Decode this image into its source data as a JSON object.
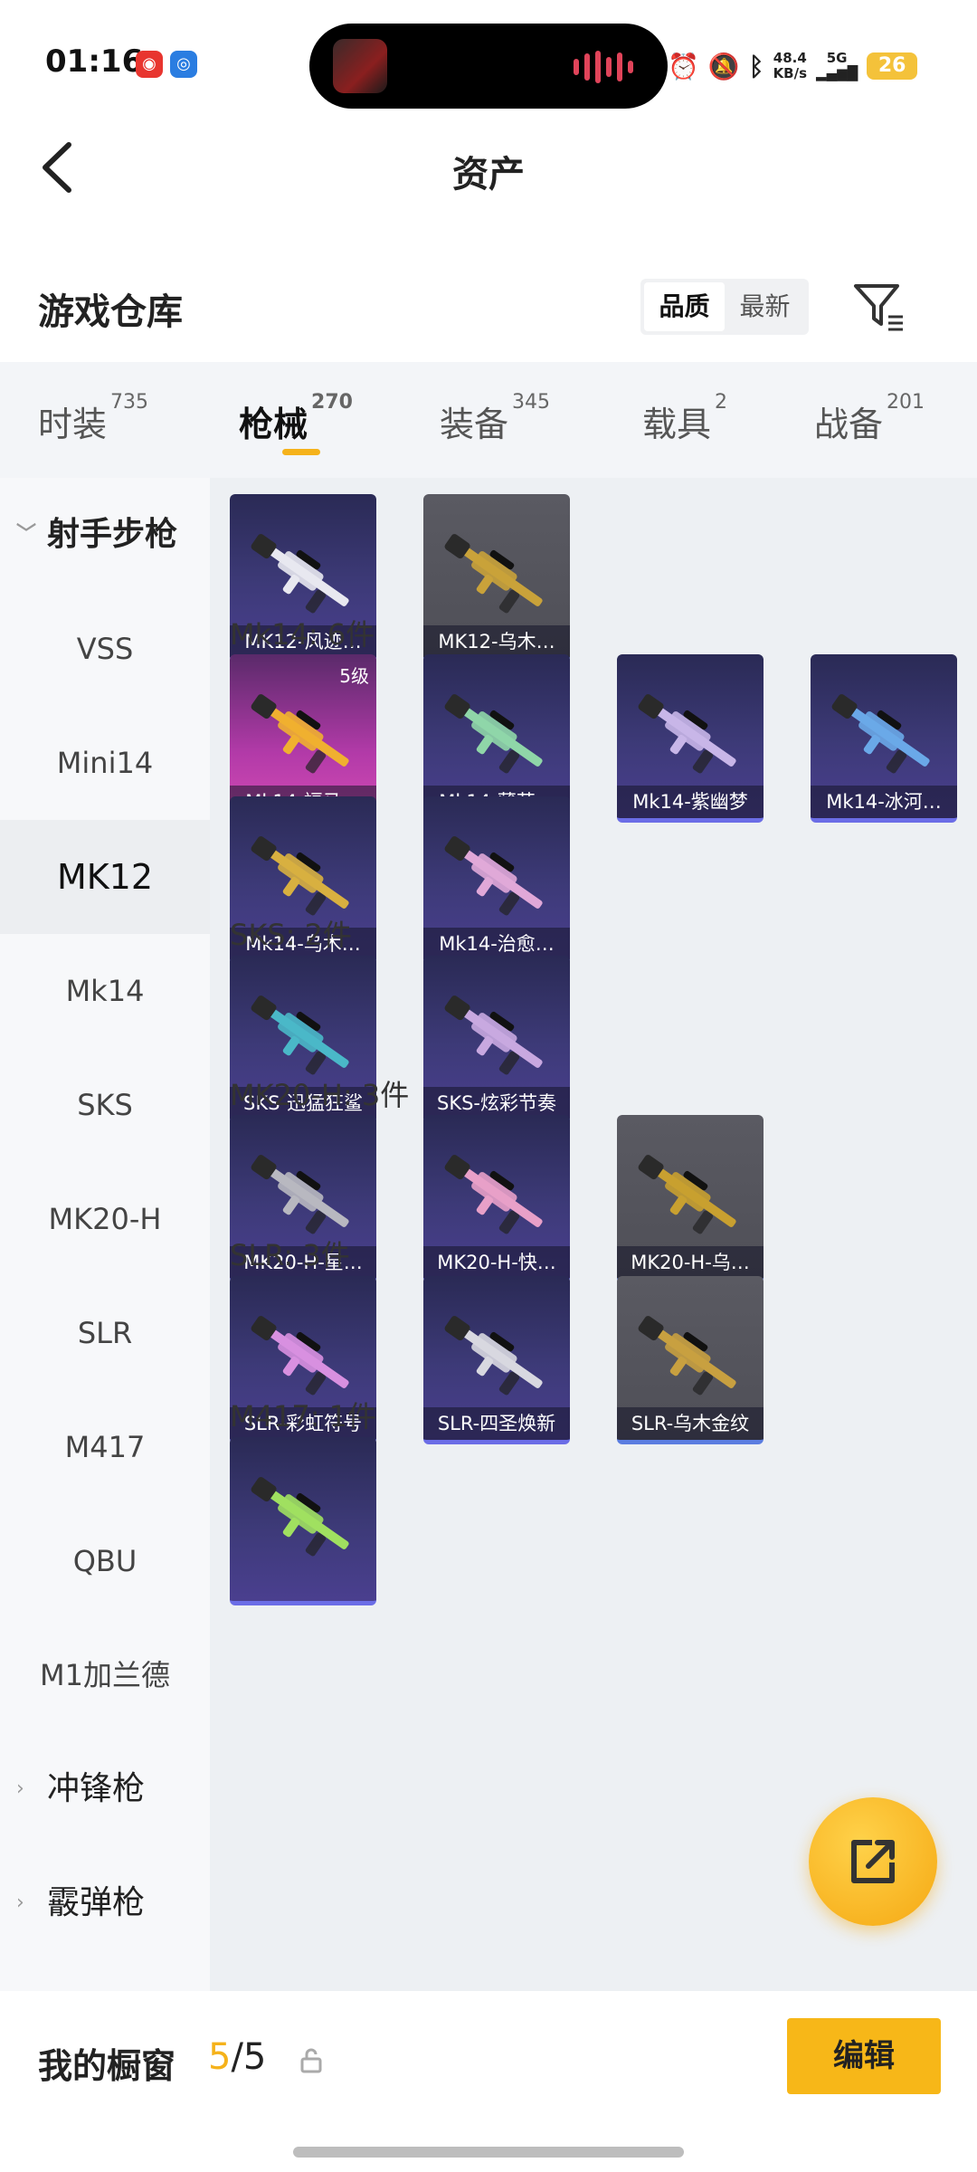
{
  "status_bar": {
    "time": "01:16",
    "net_speed_value": "48.4",
    "net_speed_unit": "KB/s",
    "network": "5G",
    "battery": "26"
  },
  "header": {
    "title": "资产"
  },
  "section": {
    "title": "游戏仓库",
    "sort_options": [
      "品质",
      "最新"
    ],
    "sort_selected": "品质"
  },
  "tabs": [
    {
      "label": "时装",
      "count": "735"
    },
    {
      "label": "枪械",
      "count": "270"
    },
    {
      "label": "装备",
      "count": "345"
    },
    {
      "label": "载具",
      "count": "2"
    },
    {
      "label": "战备",
      "count": "201"
    }
  ],
  "active_tab": "枪械",
  "sidebar": {
    "group_open": "射手步枪",
    "items": [
      "VSS",
      "Mini14",
      "MK12",
      "Mk14",
      "SKS",
      "MK20-H",
      "SLR",
      "M417",
      "QBU",
      "M1加兰德"
    ],
    "active_item": "MK12",
    "collapsed_groups": [
      "冲锋枪",
      "霰弹枪"
    ]
  },
  "content": {
    "groups": [
      {
        "label": "",
        "items": [
          {
            "name": "MK12-风迹…",
            "style": "purple"
          },
          {
            "name": "MK12-乌木…",
            "style": "gray"
          }
        ]
      },
      {
        "label": "Mk14: 6件",
        "items": [
          {
            "name": "Mk14-福马…",
            "style": "pink",
            "level": "5级"
          },
          {
            "name": "Mk14-薄荷…",
            "style": "purple"
          },
          {
            "name": "Mk14-紫幽梦",
            "style": "purple"
          },
          {
            "name": "Mk14-冰河…",
            "style": "purple"
          },
          {
            "name": "Mk14-乌木…",
            "style": "purple"
          },
          {
            "name": "Mk14-治愈…",
            "style": "purple"
          }
        ]
      },
      {
        "label": "SKS: 2件",
        "items": [
          {
            "name": "SKS-迅猛狂鲨",
            "style": "purple"
          },
          {
            "name": "SKS-炫彩节奏",
            "style": "purple"
          }
        ]
      },
      {
        "label": "MK20-H: 3件",
        "items": [
          {
            "name": "MK20-H-星…",
            "style": "purple"
          },
          {
            "name": "MK20-H-快…",
            "style": "purple"
          },
          {
            "name": "MK20-H-乌…",
            "style": "gray"
          }
        ]
      },
      {
        "label": "SLR: 3件",
        "items": [
          {
            "name": "SLR-彩虹符号",
            "style": "purple"
          },
          {
            "name": "SLR-四圣焕新",
            "style": "purple"
          },
          {
            "name": "SLR-乌木金纹",
            "style": "gray"
          }
        ]
      },
      {
        "label": "M417: 1件",
        "items": [
          {
            "name": "",
            "style": "purple"
          }
        ]
      }
    ]
  },
  "bottom_bar": {
    "showcase_label": "我的橱窗",
    "showcase_current": "5",
    "showcase_total": "/5",
    "edit_label": "编辑"
  }
}
